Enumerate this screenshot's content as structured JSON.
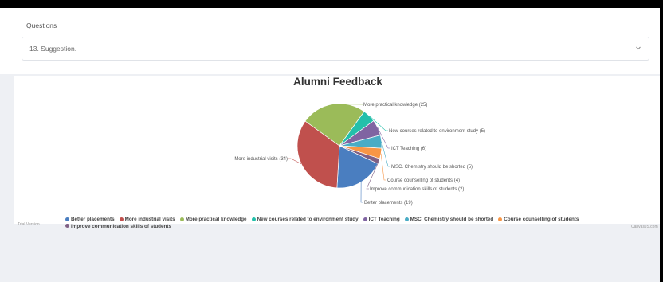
{
  "form": {
    "questions_label": "Questions",
    "selected_question": "13. Suggestion."
  },
  "chart_data": {
    "type": "pie",
    "title": "Alumni Feedback",
    "series": [
      {
        "name": "Better placements",
        "value": 19,
        "label": "Better placements (19)",
        "color": "#4a7ec0"
      },
      {
        "name": "More industrial visits",
        "value": 34,
        "label": "More industrial visits (34)",
        "color": "#c0504d"
      },
      {
        "name": "More practical knowledge",
        "value": 25,
        "label": "More practical knowledge (25)",
        "color": "#9bbb59"
      },
      {
        "name": "New courses related to environment study",
        "value": 5,
        "label": "New courses related to environment study (5)",
        "color": "#23bfaa"
      },
      {
        "name": "ICT Teaching",
        "value": 6,
        "label": "ICT Teaching (6)",
        "color": "#8064a2"
      },
      {
        "name": "MSC. Chemistry should be shorted",
        "value": 5,
        "label": "MSC. Chemistry should be shorted (5)",
        "color": "#4aacc5"
      },
      {
        "name": "Course counselling of students",
        "value": 4,
        "label": "Course counselling of students (4)",
        "color": "#f79646"
      },
      {
        "name": "Improve communication skills of students",
        "value": 2,
        "label": "Improve communication skills of students (2)",
        "color": "#7f6084"
      }
    ],
    "legend_position": "bottom"
  },
  "credits": {
    "left": "Trial Version",
    "right": "CanvasJS.com"
  }
}
